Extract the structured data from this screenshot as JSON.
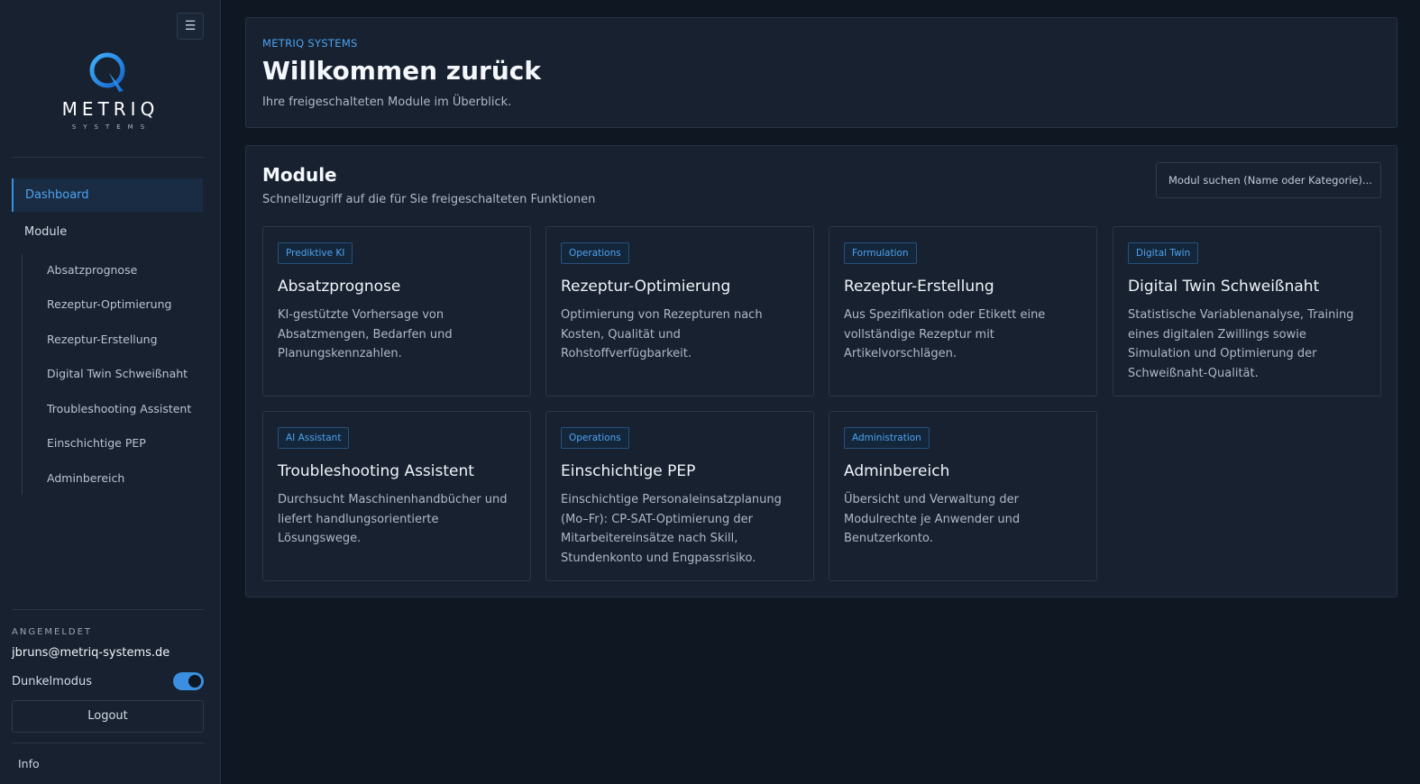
{
  "sidebar": {
    "menu_icon": "hamburger-icon",
    "logo": {
      "word": "METRIQ",
      "sub": "SYSTEMS"
    },
    "nav": {
      "dashboard": "Dashboard",
      "module": "Module",
      "items": [
        "Absatzprognose",
        "Rezeptur-Optimierung",
        "Rezeptur-Erstellung",
        "Digital Twin Schweißnaht",
        "Troubleshooting Assistent",
        "Einschichtige PEP",
        "Adminbereich"
      ]
    },
    "logged_in_label": "ANGEMELDET",
    "user_email": "jbruns@metriq-systems.de",
    "dark_mode_label": "Dunkelmodus",
    "dark_mode_on": true,
    "logout_label": "Logout",
    "info_label": "Info"
  },
  "header": {
    "kicker": "METRIQ SYSTEMS",
    "title": "Willkommen zurück",
    "subtitle": "Ihre freigeschalteten Module im Überblick."
  },
  "modules": {
    "title": "Module",
    "subtitle": "Schnellzugriff auf die für Sie freigeschalteten Funktionen",
    "search_placeholder": "Modul suchen (Name oder Kategorie)...",
    "cards": [
      {
        "badge": "Prediktive KI",
        "title": "Absatzprognose",
        "desc": "KI-gestützte Vorhersage von Absatzmengen, Bedarfen und Planungskennzahlen."
      },
      {
        "badge": "Operations",
        "title": "Rezeptur-Optimierung",
        "desc": "Optimierung von Rezepturen nach Kosten, Qualität und Rohstoffverfügbarkeit."
      },
      {
        "badge": "Formulation",
        "title": "Rezeptur-Erstellung",
        "desc": "Aus Spezifikation oder Etikett eine vollständige Rezeptur mit Artikelvorschlägen."
      },
      {
        "badge": "Digital Twin",
        "title": "Digital Twin Schweißnaht",
        "desc": "Statistische Variablenanalyse, Training eines digitalen Zwillings sowie Simulation und Optimierung der Schweißnaht-Qualität."
      },
      {
        "badge": "AI Assistant",
        "title": "Troubleshooting Assistent",
        "desc": "Durchsucht Maschinenhandbücher und liefert handlungsorientierte Lösungswege."
      },
      {
        "badge": "Operations",
        "title": "Einschichtige PEP",
        "desc": "Einschichtige Personaleinsatzplanung (Mo–Fr): CP-SAT-Optimierung der Mitarbeitereinsätze nach Skill, Stundenkonto und Engpassrisiko."
      },
      {
        "badge": "Administration",
        "title": "Adminbereich",
        "desc": "Übersicht und Verwaltung der Modulrechte je Anwender und Benutzerkonto."
      }
    ]
  },
  "colors": {
    "accent": "#3b8ee0",
    "background": "#0f1722",
    "panel": "#172130"
  }
}
